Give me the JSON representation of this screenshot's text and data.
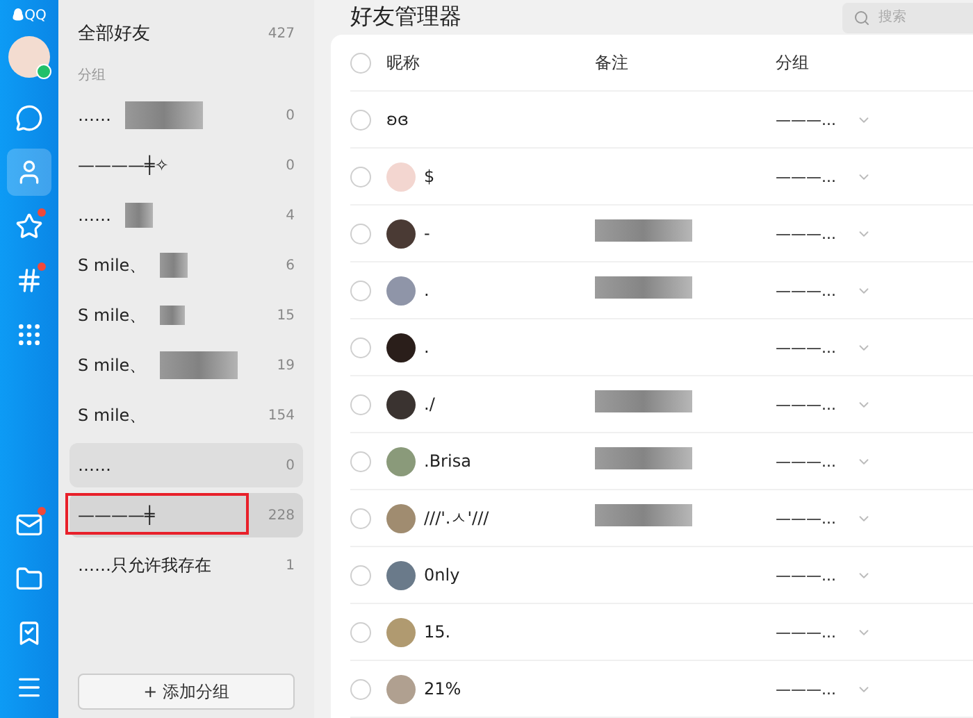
{
  "app": {
    "logo": "QQ"
  },
  "nav": [
    {
      "selected": false,
      "badge": false
    },
    {
      "selected": true,
      "badge": false
    },
    {
      "selected": false,
      "badge": true
    },
    {
      "selected": false,
      "badge": true
    },
    {
      "selected": false,
      "badge": false
    }
  ],
  "nav_bottom": [
    {
      "badge": true
    },
    {
      "badge": false
    },
    {
      "badge": false
    },
    {
      "badge": false
    }
  ],
  "sidebar": {
    "all_friends": {
      "label": "全部好友",
      "count": "427"
    },
    "section_label": "分组",
    "groups": [
      {
        "name": "……",
        "masked": true,
        "count": "0",
        "selected": false,
        "hovered": false
      },
      {
        "name": "————╪✧",
        "masked": false,
        "count": "0",
        "selected": false,
        "hovered": false
      },
      {
        "name": "……",
        "masked": true,
        "count": "4",
        "selected": false,
        "hovered": false
      },
      {
        "name": "S mile、",
        "masked": true,
        "count": "6",
        "selected": false,
        "hovered": false
      },
      {
        "name": "S mile、",
        "masked": true,
        "count": "15",
        "selected": false,
        "hovered": false
      },
      {
        "name": "S mile、",
        "masked": true,
        "count": "19",
        "selected": false,
        "hovered": false
      },
      {
        "name": "S mile、",
        "masked": false,
        "count": "154",
        "selected": false,
        "hovered": false
      },
      {
        "name": "……",
        "masked": false,
        "count": "0",
        "selected": false,
        "hovered": true
      },
      {
        "name": "————╪",
        "masked": false,
        "count": "228",
        "selected": true,
        "hovered": true
      },
      {
        "name": "……只允许我存在",
        "masked": false,
        "count": "1",
        "selected": false,
        "hovered": false
      }
    ],
    "add_button": "+ 添加分组"
  },
  "main": {
    "title": "好友管理器",
    "search": {
      "placeholder": "搜索"
    },
    "table": {
      "columns": [
        "昵称",
        "备注",
        "分组"
      ],
      "select_all": false,
      "rows": [
        {
          "checked": false,
          "avatar": false,
          "nickname": "ʚɞ",
          "remark_masked": false,
          "group": "———..."
        },
        {
          "checked": false,
          "avatar": true,
          "color": "#f3d6d0",
          "nickname": "$",
          "remark_masked": false,
          "group": "———..."
        },
        {
          "checked": false,
          "avatar": true,
          "color": "#4a3a34",
          "nickname": "-",
          "remark_masked": true,
          "group": "———..."
        },
        {
          "checked": false,
          "avatar": true,
          "color": "#8f95a8",
          "nickname": ".",
          "remark_masked": true,
          "group": "———..."
        },
        {
          "checked": false,
          "avatar": true,
          "color": "#2a1e1a",
          "nickname": ".",
          "remark_masked": false,
          "group": "———..."
        },
        {
          "checked": false,
          "avatar": true,
          "color": "#3a3330",
          "nickname": "./",
          "remark_masked": true,
          "group": "———..."
        },
        {
          "checked": false,
          "avatar": true,
          "color": "#8a9a7a",
          "nickname": ".Brisa",
          "remark_masked": true,
          "group": "———..."
        },
        {
          "checked": false,
          "avatar": true,
          "color": "#a08c70",
          "nickname": "///'.ㅅ'///",
          "remark_masked": true,
          "group": "———..."
        },
        {
          "checked": false,
          "avatar": true,
          "color": "#6a7a8a",
          "nickname": "0nly",
          "remark_masked": false,
          "group": "———..."
        },
        {
          "checked": false,
          "avatar": true,
          "color": "#b09a70",
          "nickname": "15.",
          "remark_masked": false,
          "group": "———..."
        },
        {
          "checked": false,
          "avatar": true,
          "color": "#b0a090",
          "nickname": "21%",
          "remark_masked": false,
          "group": "———..."
        }
      ]
    }
  }
}
